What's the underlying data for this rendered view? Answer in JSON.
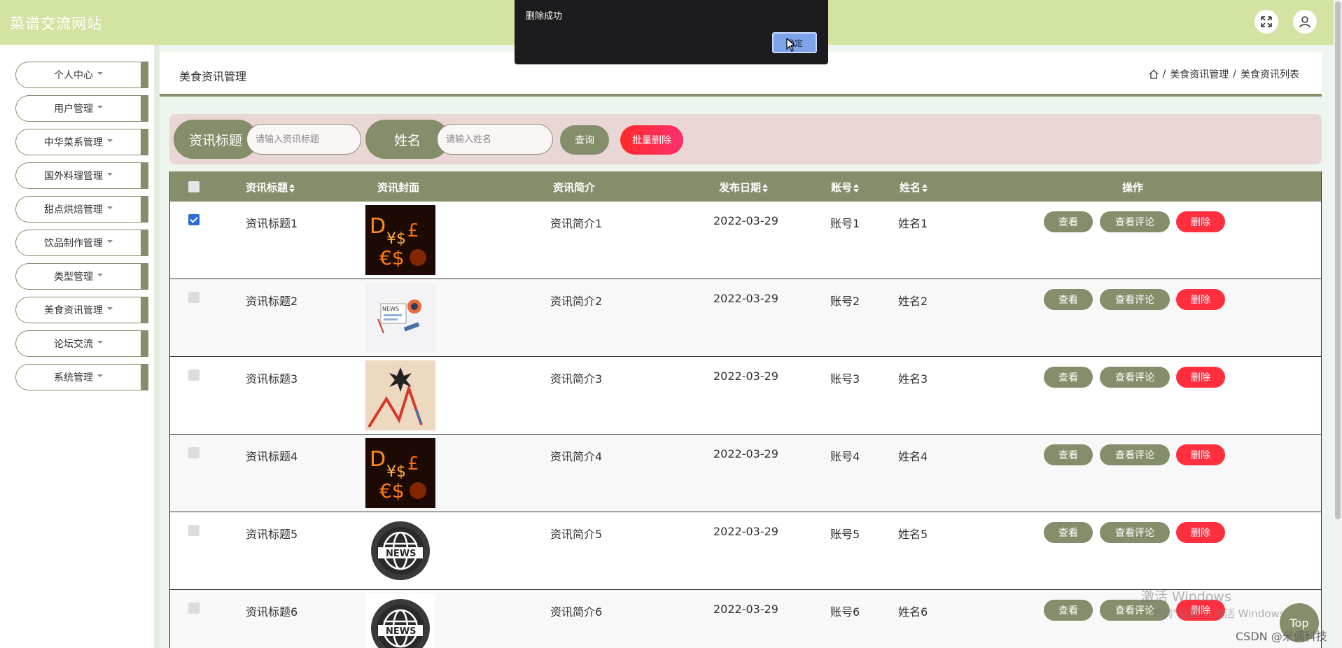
{
  "header": {
    "brand": "菜谱交流网站",
    "fullscreen_icon": "fullscreen-icon",
    "user_icon": "user-icon"
  },
  "sidebar": {
    "items": [
      {
        "label": "个人中心"
      },
      {
        "label": "用户管理"
      },
      {
        "label": "中华菜系管理"
      },
      {
        "label": "国外料理管理"
      },
      {
        "label": "甜点烘焙管理"
      },
      {
        "label": "饮品制作管理"
      },
      {
        "label": "类型管理"
      },
      {
        "label": "美食资讯管理"
      },
      {
        "label": "论坛交流"
      },
      {
        "label": "系统管理"
      }
    ]
  },
  "page": {
    "title": "美食资讯管理",
    "breadcrumb": {
      "home_icon": "home-icon",
      "separator": "/",
      "level1": "美食资讯管理",
      "level2": "美食资讯列表"
    }
  },
  "search": {
    "title_label": "资讯标题",
    "title_placeholder": "请输入资讯标题",
    "name_label": "姓名",
    "name_placeholder": "请输入姓名",
    "query_button": "查询",
    "batch_delete_button": "批量删除"
  },
  "table": {
    "columns": {
      "title": "资讯标题",
      "cover": "资讯封面",
      "summary": "资讯简介",
      "date": "发布日期",
      "account": "账号",
      "name": "姓名",
      "actions": "操作"
    },
    "action_labels": {
      "view": "查看",
      "comments": "查看评论",
      "delete": "删除"
    },
    "rows": [
      {
        "checked": true,
        "title": "资讯标题1",
        "cover": "fire-money",
        "summary": "资讯简介1",
        "date": "2022-03-29",
        "account": "账号1",
        "name": "姓名1"
      },
      {
        "checked": false,
        "title": "资讯标题2",
        "cover": "news-illustration",
        "summary": "资讯简介2",
        "date": "2022-03-29",
        "account": "账号2",
        "name": "姓名2"
      },
      {
        "checked": false,
        "title": "资讯标题3",
        "cover": "market-chart",
        "summary": "资讯简介3",
        "date": "2022-03-29",
        "account": "账号3",
        "name": "姓名3"
      },
      {
        "checked": false,
        "title": "资讯标题4",
        "cover": "fire-money",
        "summary": "资讯简介4",
        "date": "2022-03-29",
        "account": "账号4",
        "name": "姓名4"
      },
      {
        "checked": false,
        "title": "资讯标题5",
        "cover": "news-globe",
        "summary": "资讯简介5",
        "date": "2022-03-29",
        "account": "账号5",
        "name": "姓名5"
      },
      {
        "checked": false,
        "title": "资讯标题6",
        "cover": "news-globe",
        "summary": "资讯简介6",
        "date": "2022-03-29",
        "account": "账号6",
        "name": "姓名6"
      }
    ]
  },
  "dialog": {
    "message": "删除成功",
    "ok_button": "确定"
  },
  "overlay": {
    "windows_watermark": "激活 Windows",
    "windows_watermark_sub": "转到\"设置\"以激活 Windows。",
    "csdn": "CSDN @米偶科技",
    "top_button": "Top"
  },
  "colors": {
    "header_bg": "#d2e3a2",
    "accent": "#858e6a",
    "danger": "#ff2f3f",
    "search_panel_bg": "#e8d7d5"
  }
}
